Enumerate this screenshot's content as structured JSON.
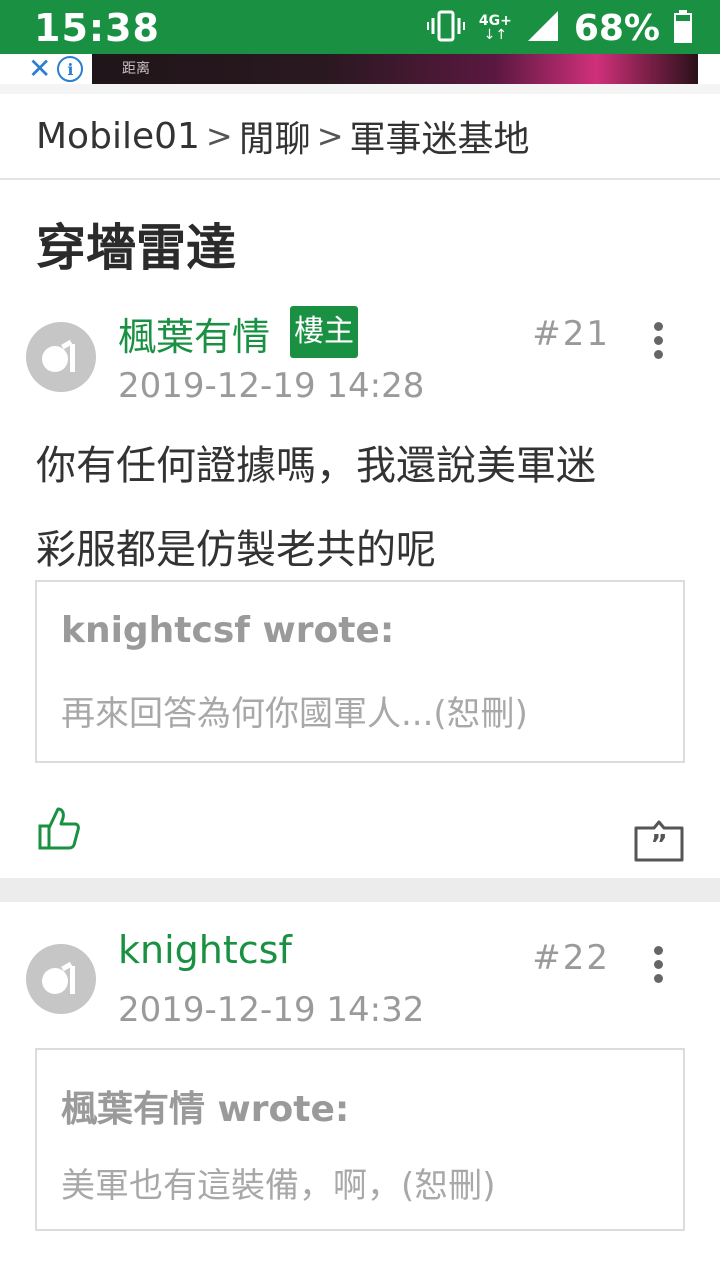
{
  "status_bar": {
    "time": "15:38",
    "network": "4G+",
    "battery_pct": "68%"
  },
  "ad": {
    "text": "距离"
  },
  "breadcrumb": {
    "items": [
      "Mobile01",
      "閒聊",
      "軍事迷基地"
    ],
    "separator": ">"
  },
  "thread": {
    "title": "穿墻雷達"
  },
  "posts": [
    {
      "author": "楓葉有情",
      "badge": "樓主",
      "date": "2019-12-19 14:28",
      "floor": "#21",
      "content_line1": "你有任何證據嗎，我還說美軍迷",
      "content_line2": "彩服都是仿製老共的呢",
      "quote": {
        "header": "knightcsf wrote:",
        "body": "再來回答為何你國軍人...(恕刪)"
      }
    },
    {
      "author": "knightcsf",
      "date": "2019-12-19 14:32",
      "floor": "#22",
      "quote": {
        "header": "楓葉有情 wrote:",
        "body": "美軍也有這裝備，啊，(恕刪)"
      }
    }
  ],
  "colors": {
    "brand_green": "#1a9142",
    "text_gray": "#9a9a9a",
    "divider": "#ececec"
  },
  "icons": [
    "vibrate-icon",
    "signal-icon",
    "battery-icon",
    "close-icon",
    "info-icon",
    "avatar-icon",
    "more-vert-icon",
    "thumbs-up-icon",
    "quote-reply-icon"
  ]
}
